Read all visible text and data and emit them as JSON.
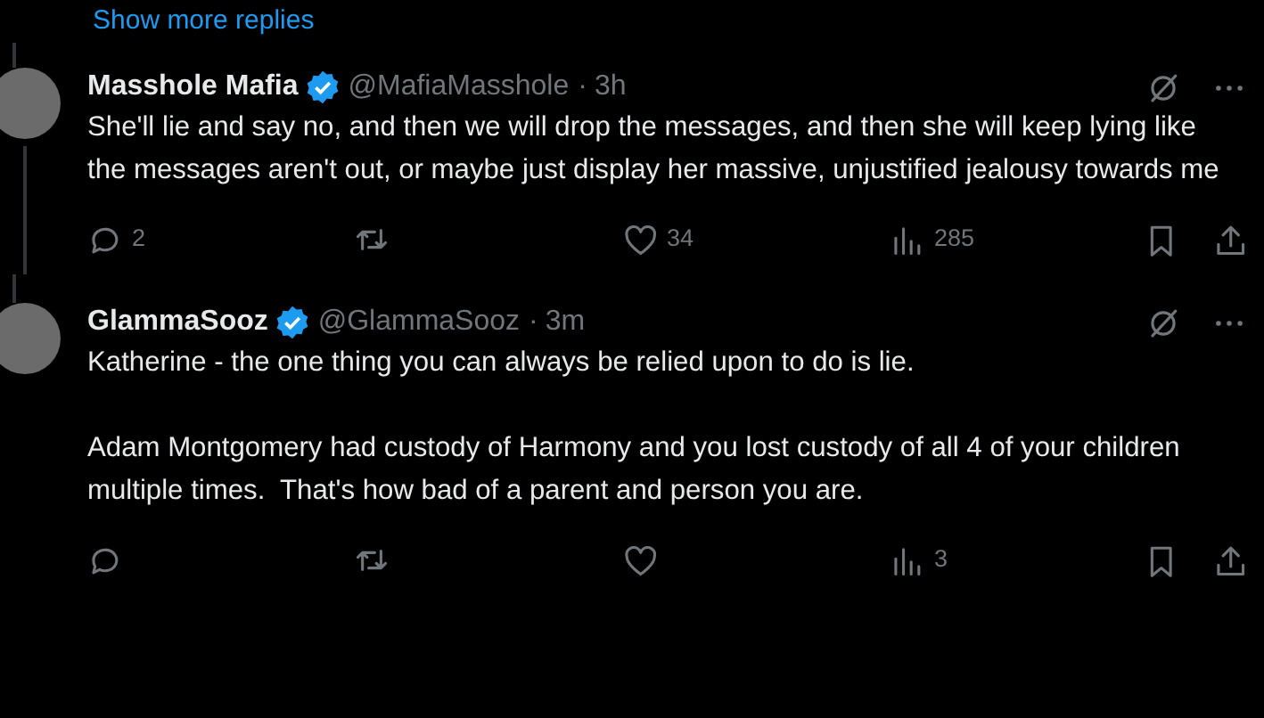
{
  "show_more_replies": "Show more replies",
  "posts": [
    {
      "name": "Masshole Mafia",
      "verified": true,
      "handle": "@MafiaMasshole",
      "separator": "·",
      "time": "3h",
      "thread_line": true,
      "paragraphs": [
        "She'll lie and say no, and then we will drop the messages, and then she will keep lying like the messages aren't out, or maybe just display her massive, unjustified jealousy towards me"
      ],
      "replies": "2",
      "likes": "34",
      "views": "285"
    },
    {
      "name": "GlammaSooz",
      "verified": true,
      "handle": "@GlammaSooz",
      "separator": "·",
      "time": "3m",
      "thread_line": false,
      "paragraphs": [
        "Katherine - the one thing you can always be relied upon to do is lie.",
        "Adam Montgomery had custody of Harmony and you lost custody of all 4 of your children multiple times.  That's how bad of a parent and person you are."
      ],
      "views": "3"
    }
  ]
}
